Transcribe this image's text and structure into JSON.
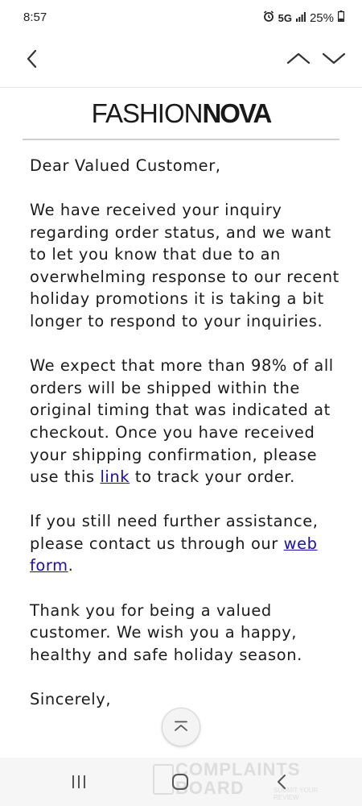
{
  "status_bar": {
    "time": "8:57",
    "network": "5G",
    "battery": "25%"
  },
  "toolbar": {
    "back_icon": "chevron-left-icon",
    "prev_icon": "chevron-up-icon",
    "next_icon": "chevron-down-icon"
  },
  "email": {
    "logo_part1": "FASHION",
    "logo_part2": "NOVA",
    "greeting": "Dear Valued Customer,",
    "paragraph1": "We have received your inquiry regarding order status, and we want to let you know that due to an overwhelming response to our recent holiday promotions it is taking a bit longer to respond to your inquiries.",
    "paragraph2_before_link": "We expect that more than 98% of all orders will be shipped within the original timing that was indicated at checkout. Once you have received your shipping confirmation, please use this ",
    "paragraph2_link": "link",
    "paragraph2_after_link": " to track your order.",
    "paragraph3_before_link": "If you still need further assistance, please contact us through our ",
    "paragraph3_link": "web form",
    "paragraph3_after_link": ".",
    "paragraph4": "Thank you for being a valued customer. We wish you a happy, healthy and safe holiday season.",
    "closing": "Sincerely,"
  },
  "watermark": {
    "line1": "COMPLAINTS",
    "line2": "BOARD",
    "sub": "SUBMIT YOUR REVIEW"
  },
  "colors": {
    "link": "#1a0dab",
    "text": "#1b1b1b",
    "nav_bar_bg": "#f6f6f6"
  }
}
